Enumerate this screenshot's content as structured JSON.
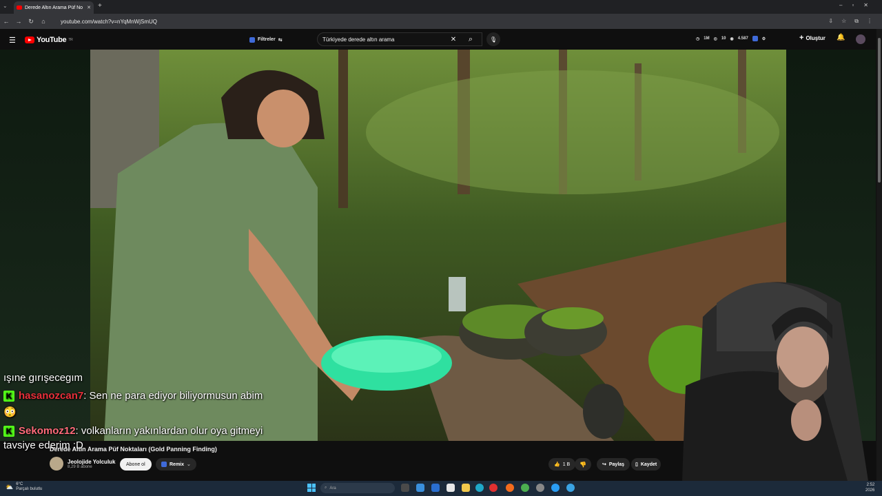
{
  "browser": {
    "tab_title": "Derede Altın Arama Püf No",
    "url": "youtube.com/watch?v=nYqMnWjSmUQ"
  },
  "header": {
    "logo_text": "YouTube",
    "logo_sup": "TR",
    "filter_label": "Filtreler",
    "search_value": "Türkiyede derede altın arama",
    "stats": [
      "1M",
      "10",
      "4.587"
    ],
    "create_label": "Oluştur"
  },
  "chat": {
    "line1": "ışıne gırışecegım",
    "line2_user": "hasanozcan7",
    "line2_text": ": Sen ne para ediyor biliyormusun abim",
    "line3_emoji": "😳",
    "line4_user": "Sekomoz12",
    "line4_text": ": volkanların yakınlardan olur oya gitmeyi",
    "line5": "tavsiye ederim :D"
  },
  "video": {
    "title": "Derede Altın Arama Püf Noktaları (Gold Panning Finding)",
    "channel_name": "Jeolojide Yolculuk",
    "subscribers": "8,29 B abone",
    "subscribe_label": "Abone ol",
    "remix_label": "Remix",
    "like_count": "1 B",
    "share_label": "Paylaş",
    "save_label": "Kaydet"
  },
  "taskbar": {
    "temp": "6°C",
    "weather": "Parçalı bulutlu",
    "search_placeholder": "Ara",
    "time": "2:52",
    "date": "2026"
  },
  "colors": {
    "yt_red": "#ff0000",
    "kick_green": "#53fc18",
    "chat_user": "#e8303a"
  }
}
